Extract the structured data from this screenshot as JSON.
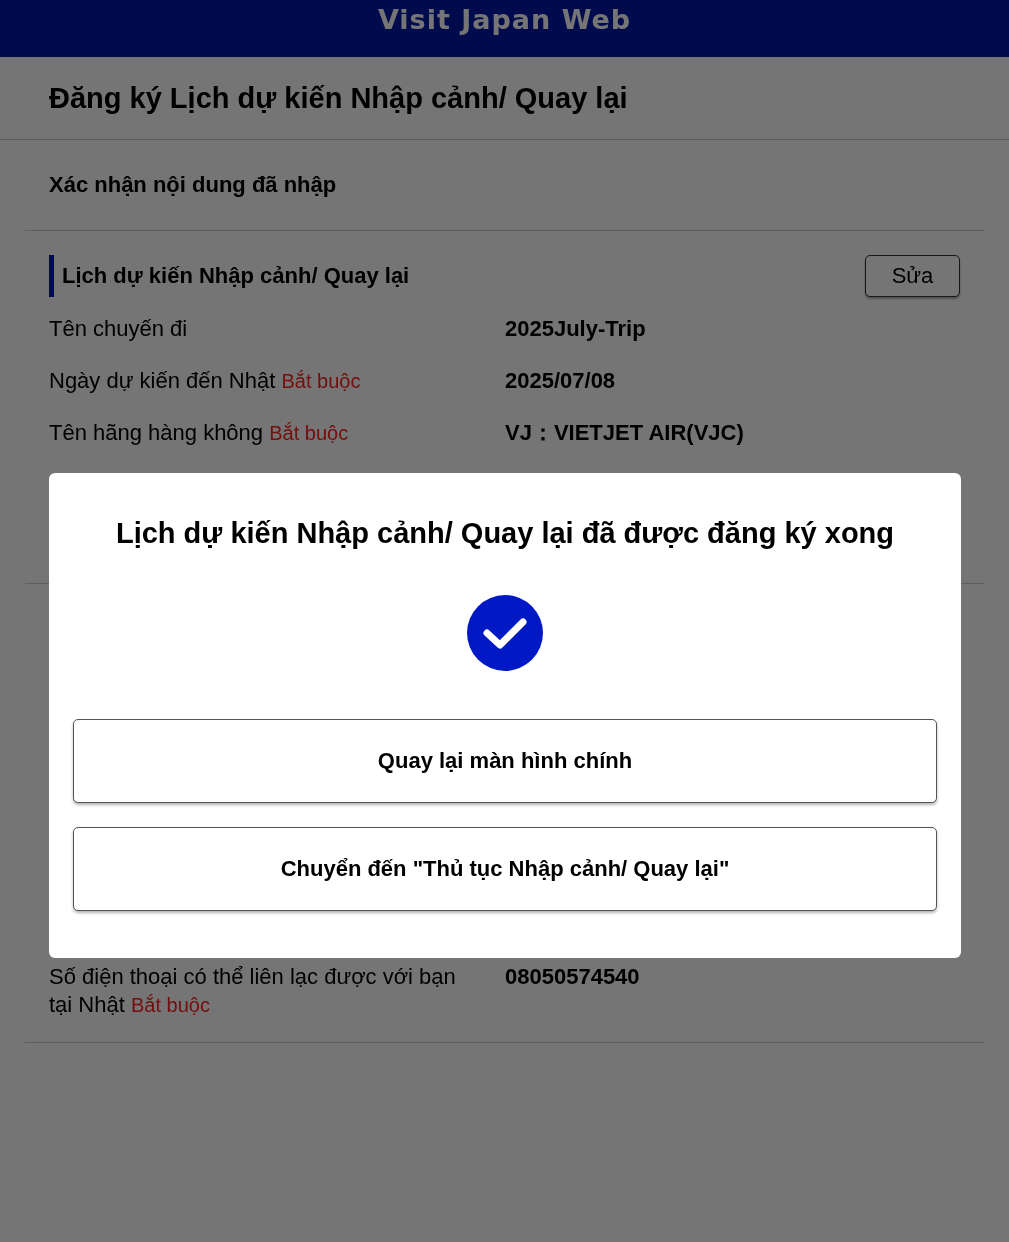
{
  "header": {
    "title": "Visit Japan Web"
  },
  "page_title": "Đăng ký Lịch dự kiến Nhập cảnh/ Quay lại",
  "section_title": "Xác nhận nội dung đã nhập",
  "group": {
    "title": "Lịch dự kiến Nhập cảnh/ Quay lại",
    "edit_button": "Sửa",
    "rows": [
      {
        "label": "Tên chuyến đi",
        "value": "2025July-Trip"
      },
      {
        "label": "Ngày dự kiến đến Nhật",
        "badge": "Bắt buộc",
        "value": "2025/07/08"
      },
      {
        "label": "Tên hãng hàng không",
        "badge": "Bắt buộc",
        "value": "VJ：VIETJET AIR(VJC)"
      }
    ]
  },
  "group_2": {
    "rows": [
      {
        "label": "Số điện thoại có thể liên lạc được với bạn tại Nhật",
        "badge": "Bắt buộc",
        "value": "08050574540"
      }
    ]
  },
  "modal": {
    "title": "Lịch dự kiến Nhập cảnh/ Quay lại đã được đăng ký xong",
    "buttons": [
      "Quay lại màn hình chính",
      "Chuyển đến \"Thủ tục Nhập cảnh/ Quay lại\""
    ]
  }
}
